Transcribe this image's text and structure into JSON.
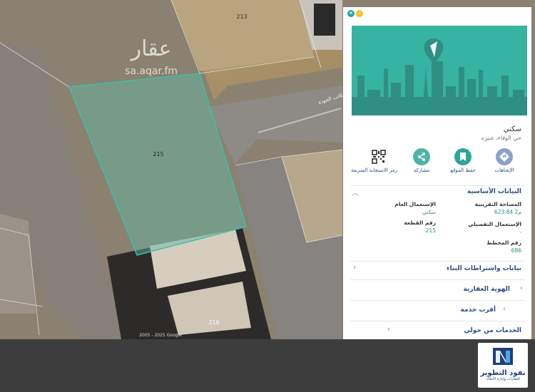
{
  "map": {
    "watermark_brand": "عقار",
    "watermark_url": "sa.aqar.fm",
    "parcel_selected": "215",
    "parcel_north": "213",
    "parcel_south": "216",
    "street_name": "مكاتب الجودة",
    "footer_text": "2005 - 2025 Google"
  },
  "panel": {
    "close_icon": "close-icon",
    "title": "سكني",
    "subtitle": "حي الوفاء، عنيزه",
    "actions": [
      {
        "label": "الإتجاهات",
        "icon": "directions-icon"
      },
      {
        "label": "حفظ الموقع",
        "icon": "bookmark-icon"
      },
      {
        "label": "مشاركة",
        "icon": "share-icon"
      },
      {
        "label": "رمز الاستجابة السريعة",
        "icon": "qr-code-icon"
      }
    ],
    "basic_section": {
      "heading": "البيانات الأساسية",
      "area_label": "المساحة التقريبية",
      "area_value": "623.84 م2",
      "general_use_label": "الإستعمال العام",
      "general_use_value": "سكني",
      "detailed_use_label": "الإستعمال التفصيلي",
      "detailed_use_value": "-",
      "plot_label": "رقم القطعة",
      "plot_value": "215",
      "plan_label": "رقم المخطط",
      "plan_value": "686"
    },
    "sections": [
      "بيانات واشتراطات البناء",
      "الهوية العقارية",
      "أقرب خدمة",
      "الخدمات من حولي"
    ]
  },
  "logo": {
    "name": "نفوذ التطوير",
    "tagline": "للعقارات وإدارة الأملاك"
  },
  "colors": {
    "teal": "#37b3a3",
    "navy": "#2f4e86",
    "parcel_fill": "#5fb8a8"
  }
}
